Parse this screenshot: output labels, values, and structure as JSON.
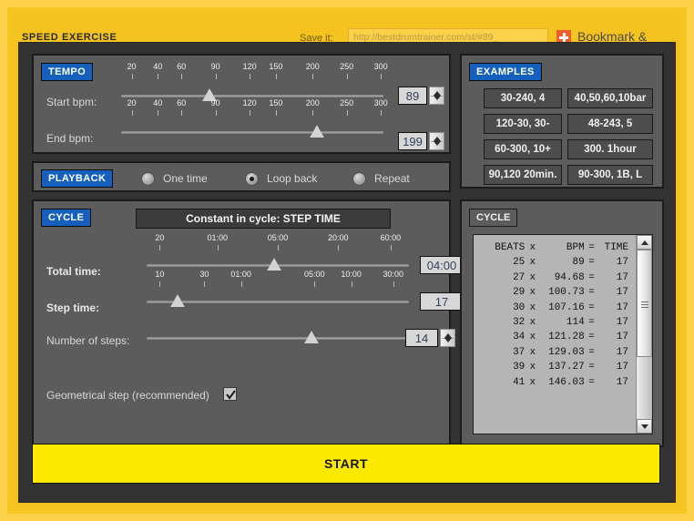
{
  "header": {
    "title": "SPEED EXERCISE",
    "save_label": "Save it:",
    "save_value": "http://bestdrumtrainer.com/st/#89_",
    "bookmark_label": "Bookmark & Share",
    "bookmark_icon": "plus-icon"
  },
  "tempo": {
    "tag": "TEMPO",
    "start_label": "Start bpm:",
    "start_value": "89",
    "start_ticks": [
      "20",
      "40",
      "60",
      "90",
      "120",
      "150",
      "200",
      "250",
      "300"
    ],
    "end_label": "End bpm:",
    "end_value": "199",
    "end_ticks": [
      "20",
      "40",
      "60",
      "90",
      "120",
      "150",
      "200",
      "250",
      "300"
    ]
  },
  "examples": {
    "tag": "EXAMPLES",
    "buttons": [
      "30-240, 4",
      "40,50,60,10bar",
      "120-30, 30-",
      "48-243, 5",
      "60-300, 10+",
      "300. 1hour",
      "90,120 20min.",
      "90-300, 1B, L"
    ]
  },
  "playback": {
    "tag": "PLAYBACK",
    "options": [
      {
        "label": "One time",
        "selected": false
      },
      {
        "label": "Loop back",
        "selected": true
      },
      {
        "label": "Repeat",
        "selected": false
      }
    ]
  },
  "cycle": {
    "tag": "CYCLE",
    "constant_bar": "Constant in cycle: STEP TIME",
    "total_time_label": "Total time:",
    "total_time_value": "04:00",
    "total_time_ticks": [
      "20",
      "01:00",
      "05:00",
      "20:00",
      "60:00"
    ],
    "step_time_label": "Step time:",
    "step_time_value": "17",
    "step_time_ticks": [
      "10",
      "30",
      "01:00",
      "05:00",
      "10:00",
      "30:00"
    ],
    "steps_label": "Number of steps:",
    "steps_value": "14",
    "geometrical_label": "Geometrical step (recommended)",
    "geometrical_checked": true
  },
  "cycle_list": {
    "tag": "CYCLE",
    "headers": {
      "beats": "BEATS",
      "x": "x",
      "bpm": "BPM",
      "eq": "=",
      "time": "TIME"
    },
    "rows": [
      {
        "beats": "25",
        "x": "x",
        "bpm": "89",
        "eq": "=",
        "time": "17"
      },
      {
        "beats": "27",
        "x": "x",
        "bpm": "94.68",
        "eq": "=",
        "time": "17"
      },
      {
        "beats": "29",
        "x": "x",
        "bpm": "100.73",
        "eq": "=",
        "time": "17"
      },
      {
        "beats": "30",
        "x": "x",
        "bpm": "107.16",
        "eq": "=",
        "time": "17"
      },
      {
        "beats": "32",
        "x": "x",
        "bpm": "114",
        "eq": "=",
        "time": "17"
      },
      {
        "beats": "34",
        "x": "x",
        "bpm": "121.28",
        "eq": "=",
        "time": "17"
      },
      {
        "beats": "37",
        "x": "x",
        "bpm": "129.03",
        "eq": "=",
        "time": "17"
      },
      {
        "beats": "39",
        "x": "x",
        "bpm": "137.27",
        "eq": "=",
        "time": "17"
      },
      {
        "beats": "41",
        "x": "x",
        "bpm": "146.03",
        "eq": "=",
        "time": "17"
      }
    ]
  },
  "footer": {
    "start_label": "START"
  },
  "colors": {
    "gold": "#f5c31f",
    "page_yellow": "#fdd24a",
    "tag_blue": "#1560bd",
    "panel": "#5c5c5c",
    "dark": "#333333",
    "start_yellow": "#fde900"
  }
}
